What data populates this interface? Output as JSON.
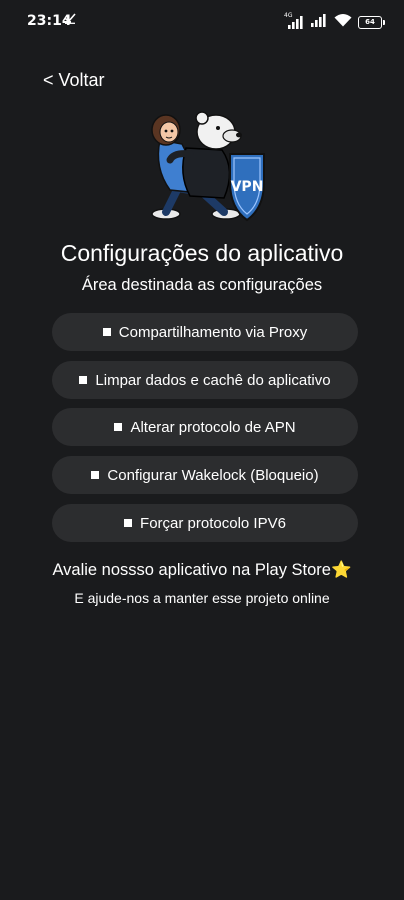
{
  "status_bar": {
    "time": "23:14",
    "signal_tag": "4G",
    "battery": "64"
  },
  "header": {
    "back_label": "< Voltar"
  },
  "hero": {
    "badge_text": "VPN"
  },
  "main": {
    "title": "Configurações do aplicativo",
    "subtitle": "Área destinada as configurações",
    "options": [
      {
        "label": "Compartilhamento via Proxy"
      },
      {
        "label": "Limpar dados e cachê do aplicativo"
      },
      {
        "label": "Alterar protocolo de APN"
      },
      {
        "label": "Configurar Wakelock (Bloqueio)"
      },
      {
        "label": "Forçar protocolo IPV6"
      }
    ]
  },
  "footer": {
    "rate_text": "Avalie nossso aplicativo na Play Store",
    "rate_star": "⭐",
    "help_text": "E ajude-nos a manter esse projeto online"
  },
  "colors": {
    "background": "#1a1b1d",
    "button": "#2c2d2f",
    "text": "#ffffff",
    "shield": "#2f6fbd"
  }
}
